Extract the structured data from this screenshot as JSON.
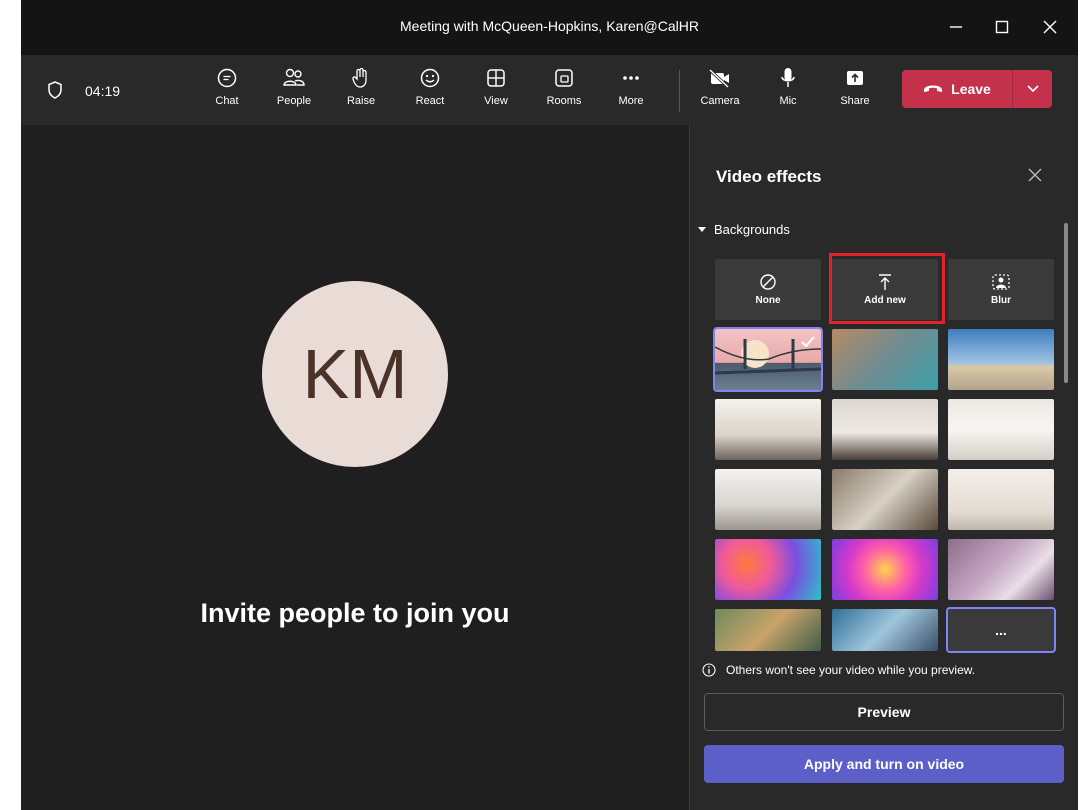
{
  "window": {
    "title": "Meeting with McQueen-Hopkins, Karen@CalHR"
  },
  "toolbar": {
    "timer": "04:19",
    "buttons": [
      "Chat",
      "People",
      "Raise",
      "React",
      "View",
      "Rooms",
      "More",
      "Camera",
      "Mic",
      "Share"
    ],
    "leave_label": "Leave"
  },
  "stage": {
    "initials": "KM",
    "invite_text": "Invite people to join you"
  },
  "panel": {
    "title": "Video effects",
    "section": "Backgrounds",
    "options": [
      "None",
      "Add new",
      "Blur"
    ],
    "more_label": "...",
    "note": "Others won't see your video while you preview.",
    "preview_label": "Preview",
    "apply_label": "Apply and turn on video"
  },
  "colors": {
    "leave": "#c4314b",
    "apply": "#5b5fc7",
    "highlight": "#e0232a",
    "selected": "#7f85f5"
  }
}
